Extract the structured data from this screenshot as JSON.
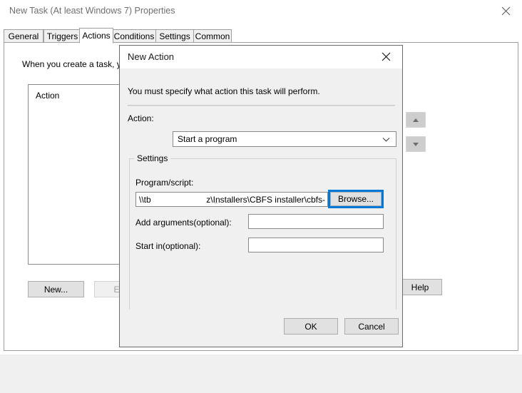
{
  "parent_window": {
    "title": "New Task (At least Windows 7) Properties",
    "close_icon": "close-icon",
    "tabs": [
      {
        "label": "General",
        "selected": false
      },
      {
        "label": "Triggers",
        "selected": false
      },
      {
        "label": "Actions",
        "selected": true
      },
      {
        "label": "Conditions",
        "selected": false
      },
      {
        "label": "Settings",
        "selected": false
      },
      {
        "label": "Common",
        "selected": false
      }
    ],
    "description": "When you create a task, yo",
    "list_column_header": "Action",
    "move_up_icon": "triangle-up-icon",
    "move_down_icon": "triangle-down-icon",
    "buttons": {
      "new": "New...",
      "edit": "Edit.",
      "help": "Help"
    }
  },
  "modal": {
    "title": "New Action",
    "close_icon": "close-icon",
    "instruction": "You must specify what action this task will perform.",
    "action_label": "Action:",
    "action_value": "Start a program",
    "action_dropdown_icon": "chevron-down-icon",
    "settings_group_label": "Settings",
    "program_script_label": "Program/script:",
    "program_script_value_left": "\\\\tb",
    "program_script_value_right": "z\\Installers\\CBFS installer\\cbfs-",
    "browse_button": "Browse...",
    "add_arguments_label": "Add arguments(optional):",
    "add_arguments_value": "",
    "start_in_label": "Start in(optional):",
    "start_in_value": "",
    "ok_button": "OK",
    "cancel_button": "Cancel"
  },
  "colors": {
    "focus_ring": "#0078D7",
    "dialog_bg": "#F0F0F0",
    "window_bg": "#FFFFFF",
    "button_bg": "#E1E1E1",
    "border": "#8A8A8A",
    "title_text": "#6E6E6E"
  }
}
